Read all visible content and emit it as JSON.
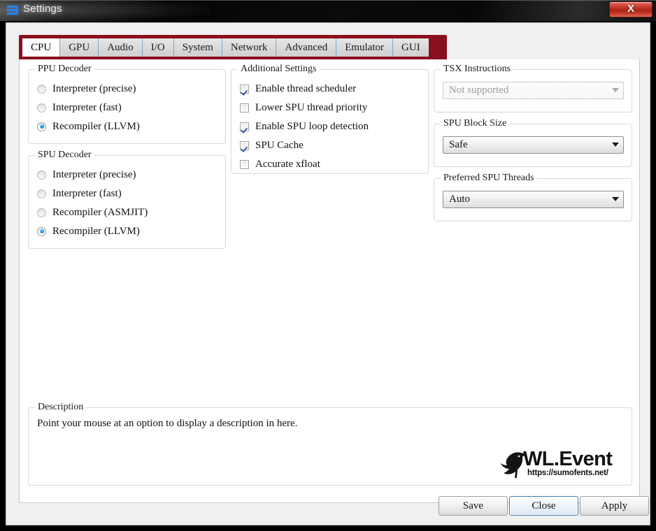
{
  "window": {
    "title": "Settings",
    "icon": "menu-bars-icon",
    "close_label": "X",
    "accent_red": "#8a0f1e",
    "titlebar_color": "#0a0a0a",
    "client_bg": "#f0f0f0"
  },
  "tabs": [
    {
      "label": "CPU",
      "active": true
    },
    {
      "label": "GPU",
      "active": false
    },
    {
      "label": "Audio",
      "active": false
    },
    {
      "label": "I/O",
      "active": false
    },
    {
      "label": "System",
      "active": false
    },
    {
      "label": "Network",
      "active": false
    },
    {
      "label": "Advanced",
      "active": false
    },
    {
      "label": "Emulator",
      "active": false
    },
    {
      "label": "GUI",
      "active": false
    }
  ],
  "ppu_decoder": {
    "legend": "PPU Decoder",
    "options": [
      {
        "label": "Interpreter (precise)",
        "checked": false
      },
      {
        "label": "Interpreter (fast)",
        "checked": false
      },
      {
        "label": "Recompiler (LLVM)",
        "checked": true
      }
    ]
  },
  "spu_decoder": {
    "legend": "SPU Decoder",
    "options": [
      {
        "label": "Interpreter (precise)",
        "checked": false
      },
      {
        "label": "Interpreter (fast)",
        "checked": false
      },
      {
        "label": "Recompiler (ASMJIT)",
        "checked": false
      },
      {
        "label": "Recompiler (LLVM)",
        "checked": true
      }
    ]
  },
  "additional_settings": {
    "legend": "Additional Settings",
    "options": [
      {
        "label": "Enable thread scheduler",
        "checked": true
      },
      {
        "label": "Lower SPU thread priority",
        "checked": false
      },
      {
        "label": "Enable SPU loop detection",
        "checked": true
      },
      {
        "label": "SPU Cache",
        "checked": true
      },
      {
        "label": "Accurate xfloat",
        "checked": false
      }
    ]
  },
  "tsx_instructions": {
    "legend": "TSX Instructions",
    "value": "Not supported",
    "disabled": true
  },
  "spu_block_size": {
    "legend": "SPU Block Size",
    "value": "Safe",
    "disabled": false
  },
  "preferred_spu_threads": {
    "legend": "Preferred SPU Threads",
    "value": "Auto",
    "disabled": false
  },
  "description": {
    "legend": "Description",
    "text": "Point your mouse at an option to display a description in here."
  },
  "watermark": {
    "main": "WL.Event",
    "sub": "https://sumofents.net/"
  },
  "buttons": {
    "save": "Save",
    "close": "Close",
    "apply": "Apply"
  }
}
